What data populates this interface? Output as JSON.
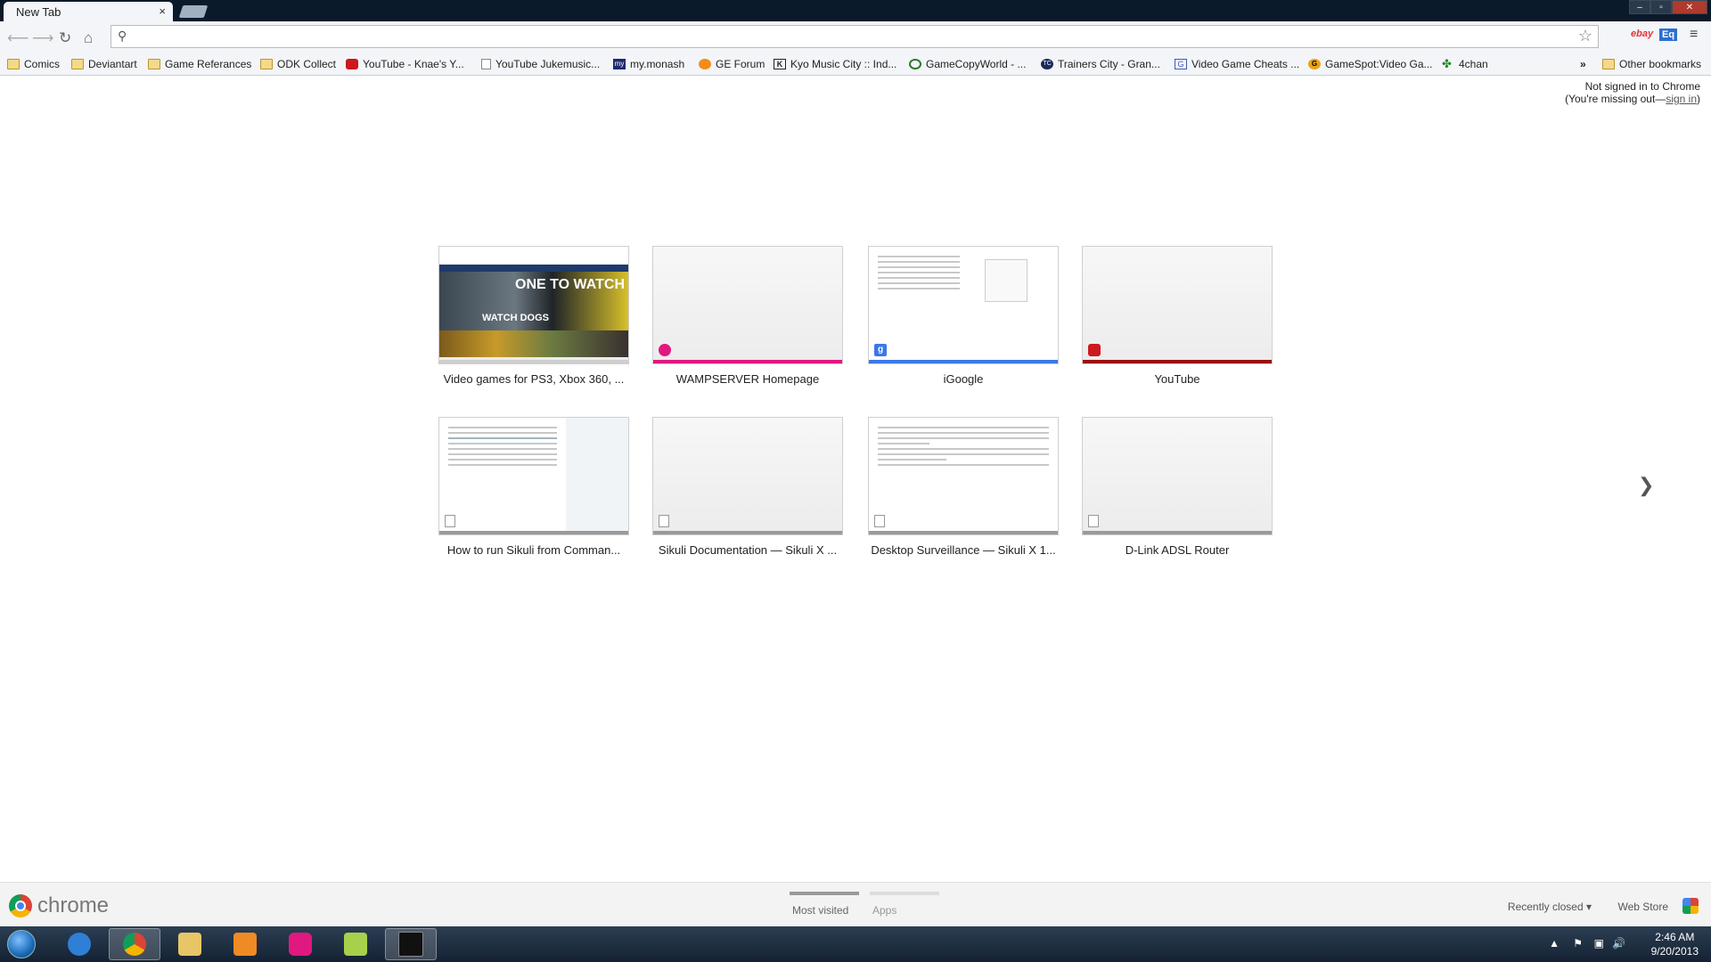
{
  "browser": {
    "tab_title": "New Tab",
    "tab_close": "×",
    "omnibox_value": "",
    "ext_ebay": "ebay",
    "ext_dict": "Eq"
  },
  "bookmarks": [
    {
      "label": "Comics",
      "icon": "folder-icon"
    },
    {
      "label": "Deviantart",
      "icon": "folder-icon"
    },
    {
      "label": "Game Referances",
      "icon": "folder-icon"
    },
    {
      "label": "ODK Collect",
      "icon": "folder-icon"
    },
    {
      "label": "YouTube - Knae's Y...",
      "icon": "youtube-icon"
    },
    {
      "label": "YouTube Jukemusic...",
      "icon": "page-icon"
    },
    {
      "label": "my.monash",
      "icon": "monash-icon"
    },
    {
      "label": "GE Forum",
      "icon": "ge-icon"
    },
    {
      "label": "Kyo Music City :: Ind...",
      "icon": "kyo-icon"
    },
    {
      "label": "GameCopyWorld - ...",
      "icon": "gamecopyworld-icon"
    },
    {
      "label": "Trainers City - Gran...",
      "icon": "trainerscity-icon"
    },
    {
      "label": "Video Game Cheats ...",
      "icon": "videogamecheats-icon"
    },
    {
      "label": "GameSpot:Video Ga...",
      "icon": "gamespot-icon"
    },
    {
      "label": "4chan",
      "icon": "4chan-icon"
    }
  ],
  "bookmarks_overflow": "»",
  "other_bookmarks": "Other bookmarks",
  "signin": {
    "line1": "Not signed in to Chrome",
    "line2_prefix": "(You're missing out—",
    "link": "sign in",
    "line2_suffix": ")"
  },
  "tiles": [
    {
      "label": "Video games for PS3, Xbox 360, ...",
      "accent": "#cfcfcf",
      "thumb": "game"
    },
    {
      "label": "WAMPSERVER Homepage",
      "accent": "#e0187f",
      "thumb": "blank"
    },
    {
      "label": "iGoogle",
      "accent": "#3b78e7",
      "thumb": "doc"
    },
    {
      "label": "YouTube",
      "accent": "#9b1010",
      "thumb": "blank"
    },
    {
      "label": "How to run Sikuli from Comman...",
      "accent": "#9a9a9a",
      "thumb": "sikuli"
    },
    {
      "label": "Sikuli Documentation — Sikuli X ...",
      "accent": "#9a9a9a",
      "thumb": "blank"
    },
    {
      "label": "Desktop Surveillance — Sikuli X 1...",
      "accent": "#9a9a9a",
      "thumb": "doc"
    },
    {
      "label": "D-Link ADSL Router",
      "accent": "#9a9a9a",
      "thumb": "blank"
    }
  ],
  "game_thumb": {
    "hero_text": "ONE TO WATCH",
    "logo_text": "WATCH DOGS"
  },
  "next_arrow": "❯",
  "footer": {
    "logo": "chrome",
    "tab_most_visited": "Most visited",
    "tab_apps": "Apps",
    "recently_closed": "Recently closed ▾",
    "web_store": "Web Store"
  },
  "taskbar": {
    "time": "2:46 AM",
    "date": "9/20/2013"
  }
}
